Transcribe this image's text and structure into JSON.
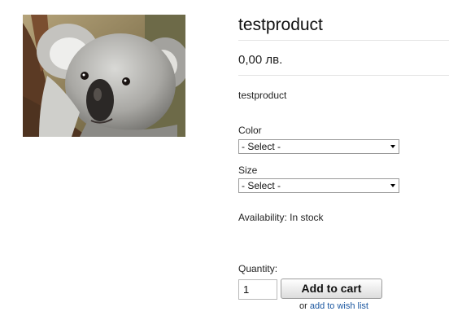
{
  "product": {
    "image_alt": "koala",
    "title": "testproduct",
    "price": "0,00 лв.",
    "description": "testproduct",
    "availability": "Availability: In stock"
  },
  "options": {
    "color": {
      "label": "Color",
      "selected": "- Select -"
    },
    "size": {
      "label": "Size",
      "selected": "- Select -"
    }
  },
  "purchase": {
    "quantity_label": "Quantity:",
    "quantity_value": "1",
    "add_to_cart_label": "Add to cart",
    "or_text": "or",
    "wish_list_link": "add to wish list"
  }
}
